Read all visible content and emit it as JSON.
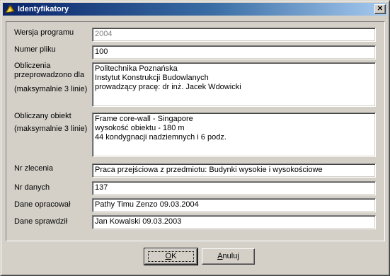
{
  "window": {
    "title": "Identyfikatory",
    "close_glyph": "✕"
  },
  "form": {
    "version": {
      "label": "Wersja programu",
      "value": "2004"
    },
    "file_number": {
      "label": "Numer pliku",
      "value": "100"
    },
    "computations_by": {
      "label_line1": "Obliczenia",
      "label_line2": "przeprowadzono dla",
      "label_hint": "(maksymalnie 3 linie)",
      "value": "Politechnika Poznańska\nInstytut Konstrukcji Budowlanych\nprowadzący pracę: dr inż. Jacek Wdowicki"
    },
    "object": {
      "label_line1": "Obliczany obiekt",
      "label_hint": "(maksymalnie 3 linie)",
      "value": "Frame core-wall - Singapore\nwysokość obiektu - 180 m\n44 kondygnacji nadziemnych i 6 podz."
    },
    "order_number": {
      "label": "Nr zlecenia",
      "value": "Praca przejściowa z przedmiotu: Budynki wysokie i wysokościowe"
    },
    "data_number": {
      "label": "Nr danych",
      "value": "137"
    },
    "prepared_by": {
      "label": "Dane opracował",
      "value": "Pathy Timu Zenzo 09.03.2004"
    },
    "checked_by": {
      "label": "Dane sprawdził",
      "value": "Jan Kowalski 09.03.2003"
    }
  },
  "buttons": {
    "ok": {
      "accel": "O",
      "rest": "K"
    },
    "cancel": {
      "accel": "A",
      "rest": "nuluj"
    }
  },
  "colors": {
    "title_gradient_start": "#0a246a",
    "title_gradient_end": "#a6caf0",
    "face": "#d4d0c8",
    "disabled_text": "#808080"
  }
}
